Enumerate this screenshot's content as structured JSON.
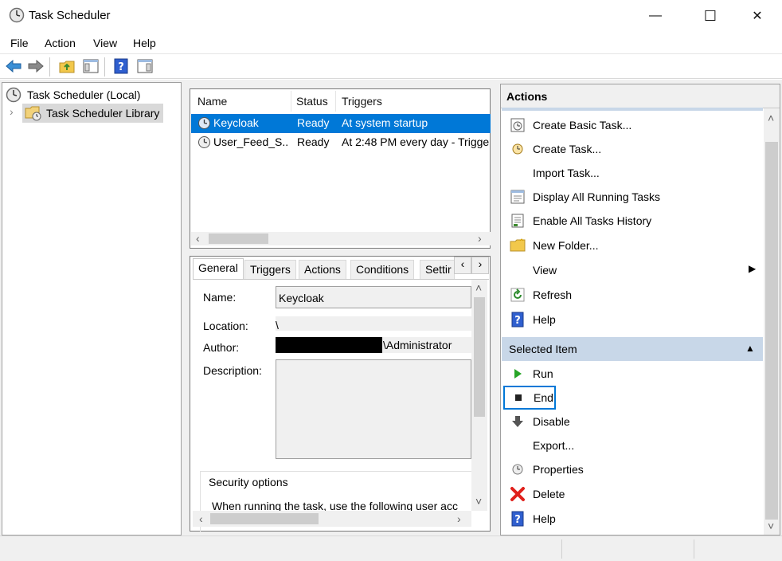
{
  "window": {
    "title": "Task Scheduler",
    "minimize_glyph": "—",
    "maximize_glyph": "☐",
    "close_glyph": "✕"
  },
  "menu": {
    "items": [
      "File",
      "Action",
      "View",
      "Help"
    ]
  },
  "toolbar": {
    "icons": [
      "back-arrow-icon",
      "forward-arrow-icon",
      "folder-up-icon",
      "show-hide-tree-icon",
      "help-icon",
      "show-hide-action-pane-icon"
    ]
  },
  "tree": {
    "root_label": "Task Scheduler (Local)",
    "library_label": "Task Scheduler Library",
    "expander": "›"
  },
  "tasklist": {
    "columns": [
      "Name",
      "Status",
      "Triggers"
    ],
    "rows": [
      {
        "name": "Keycloak",
        "status": "Ready",
        "trigger": "At system startup"
      },
      {
        "name": "User_Feed_S...",
        "status": "Ready",
        "trigger": "At 2:48 PM every day - Trigge"
      }
    ],
    "scroll_left": "‹",
    "scroll_right": "›"
  },
  "details": {
    "tabs": [
      "General",
      "Triggers",
      "Actions",
      "Conditions",
      "Settir"
    ],
    "tab_scroll_left": "‹",
    "tab_scroll_right": "›",
    "name_label": "Name:",
    "name_value": "Keycloak",
    "location_label": "Location:",
    "location_value": "\\",
    "author_label": "Author:",
    "author_value": "\\Administrator",
    "description_label": "Description:",
    "security_label": "Security options",
    "security_text": "When running the task, use the following user acc",
    "scroll_up": "˄",
    "scroll_down": "˅",
    "scroll_left": "‹",
    "scroll_right": "›"
  },
  "actions": {
    "header": "Actions",
    "scroll_up": "˄",
    "scroll_down": "˅",
    "general_items": [
      {
        "label": "Create Basic Task...",
        "icon": "create-basic-task-icon"
      },
      {
        "label": "Create Task...",
        "icon": "create-task-icon"
      },
      {
        "label": "Import Task...",
        "icon": ""
      },
      {
        "label": "Display All Running Tasks",
        "icon": "running-tasks-icon"
      },
      {
        "label": "Enable All Tasks History",
        "icon": "tasks-history-icon"
      },
      {
        "label": "New Folder...",
        "icon": "new-folder-icon"
      },
      {
        "label": "View",
        "icon": ""
      },
      {
        "label": "Refresh",
        "icon": "refresh-icon"
      },
      {
        "label": "Help",
        "icon": "help-icon"
      }
    ],
    "view_submenu_arrow": "▶",
    "selected_section": "Selected Item",
    "selected_collapse": "▲",
    "selected_items": [
      {
        "label": "Run",
        "icon": "run-icon"
      },
      {
        "label": "End",
        "icon": "end-icon"
      },
      {
        "label": "Disable",
        "icon": "disable-icon"
      },
      {
        "label": "Export...",
        "icon": ""
      },
      {
        "label": "Properties",
        "icon": "properties-icon"
      },
      {
        "label": "Delete",
        "icon": "delete-icon"
      },
      {
        "label": "Help",
        "icon": "help-icon"
      }
    ]
  },
  "colors": {
    "selection": "#0078d7",
    "section_header": "#c8d7e8",
    "focus_border": "#0078d7"
  }
}
